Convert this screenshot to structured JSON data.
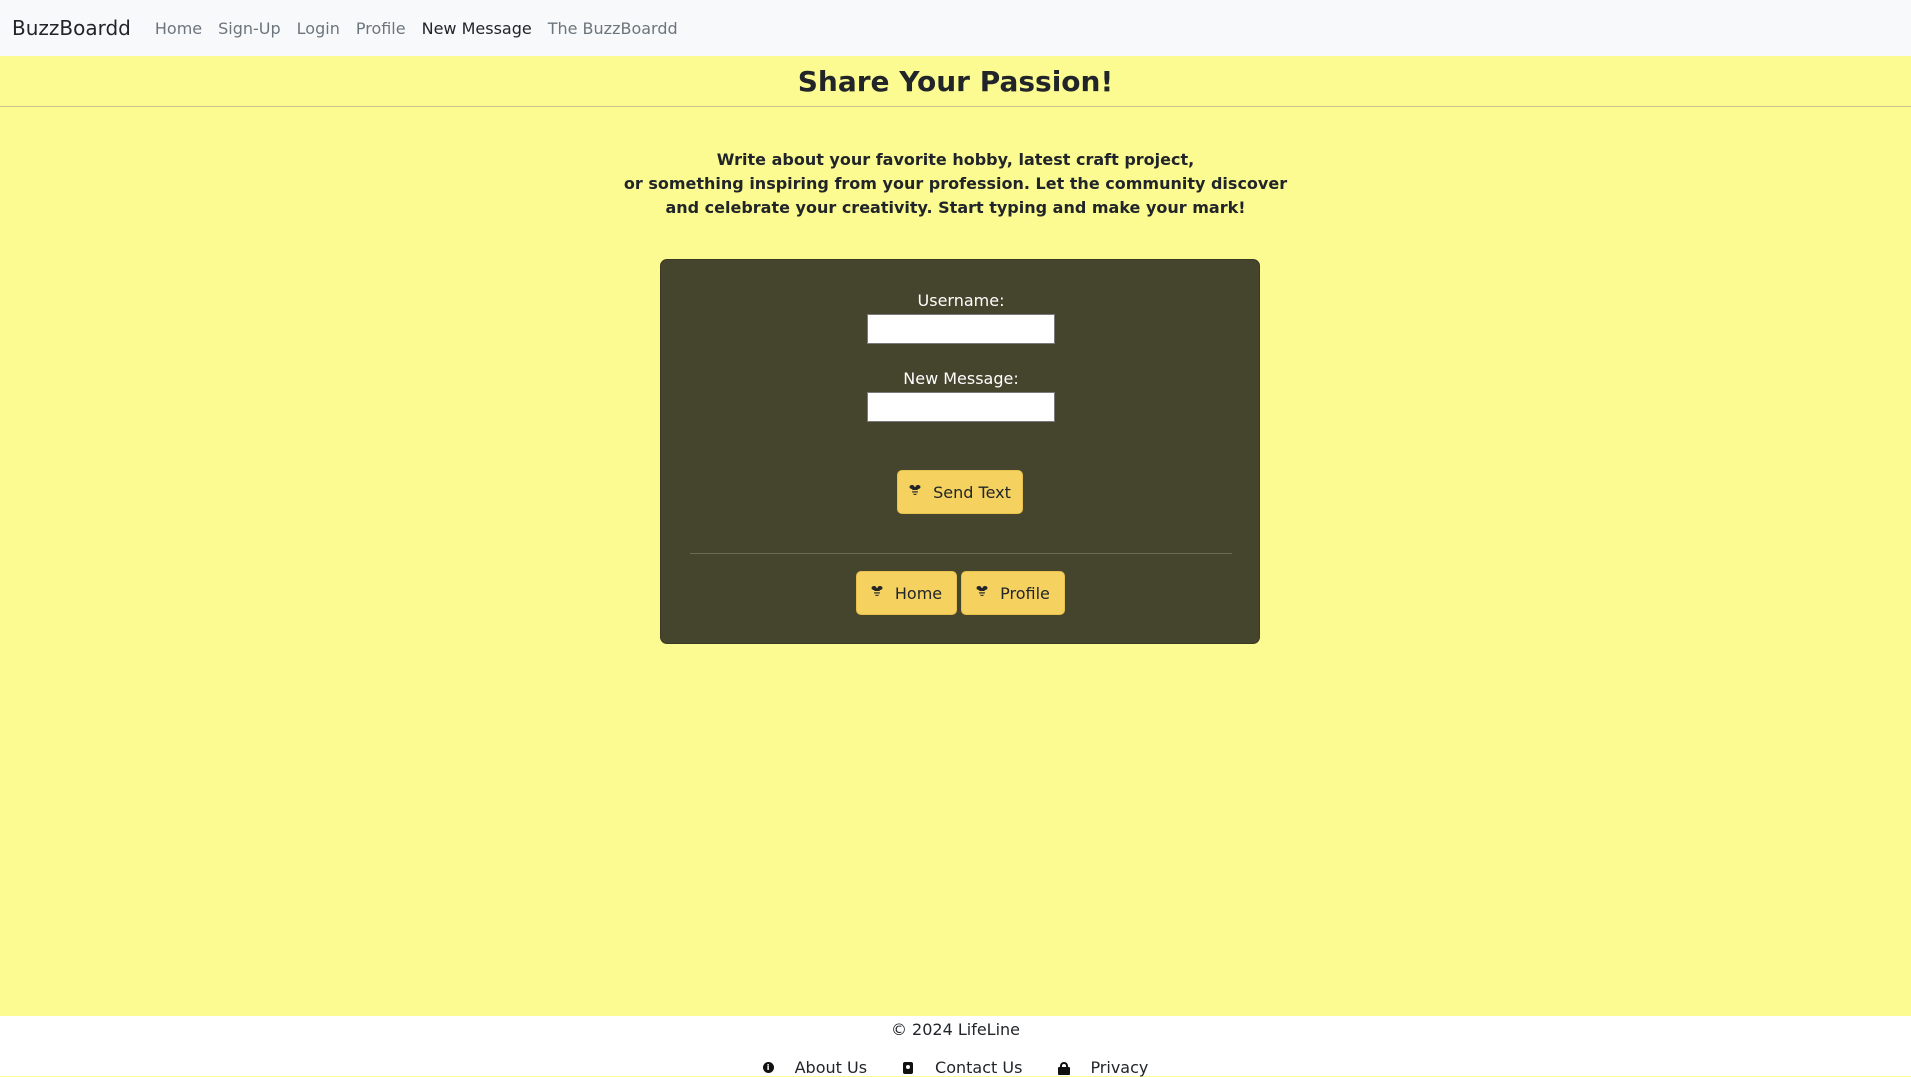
{
  "navbar": {
    "brand": "BuzzBoardd",
    "links": [
      {
        "label": "Home"
      },
      {
        "label": "Sign-Up"
      },
      {
        "label": "Login"
      },
      {
        "label": "Profile"
      },
      {
        "label": "New Message"
      },
      {
        "label": "The BuzzBoardd"
      }
    ],
    "active": "New Message"
  },
  "page": {
    "title": "Share Your Passion!",
    "intro_lines": [
      "Write about your favorite hobby, latest craft project,",
      "or something inspiring from your profession. Let the community discover",
      "and celebrate your creativity. Start typing and make your mark!"
    ]
  },
  "form": {
    "username_label": "Username:",
    "username_value": "",
    "message_label": "New Message:",
    "message_value": "",
    "send_label": "Send Text",
    "send_icon": "bee-icon",
    "home_label": "Home",
    "profile_label": "Profile"
  },
  "footer": {
    "copyright": "© 2024 LifeLine",
    "links": [
      {
        "label": "About Us",
        "icon": "info-icon"
      },
      {
        "label": "Contact Us",
        "icon": "contact-card-icon"
      },
      {
        "label": "Privacy",
        "icon": "lock-icon"
      }
    ]
  },
  "colors": {
    "page_background": "#fbfb91",
    "card_background": "#45442c",
    "button": "#f5d160"
  }
}
